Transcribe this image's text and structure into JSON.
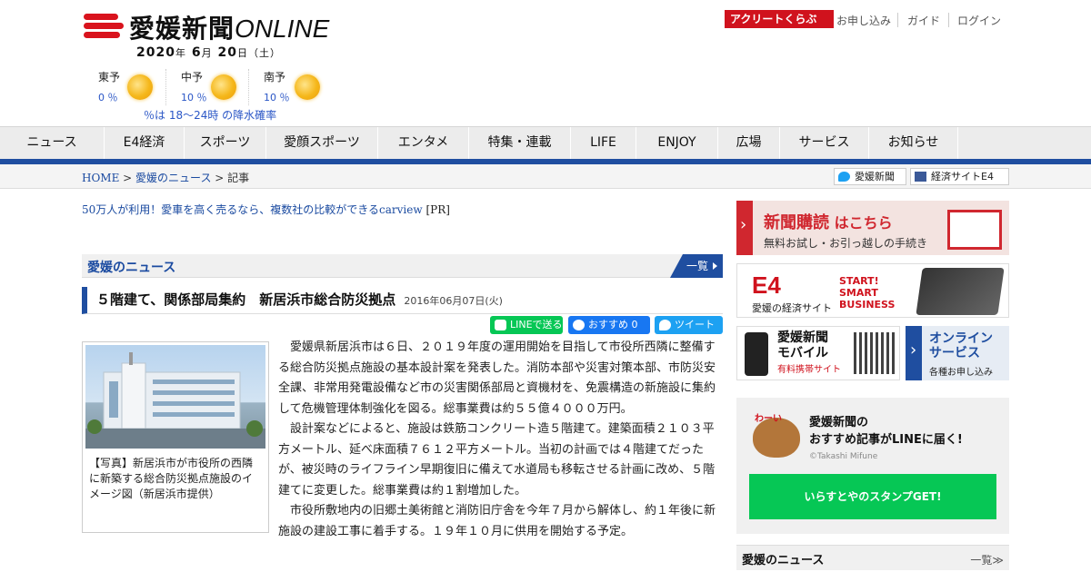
{
  "site": {
    "logo_text": "愛媛新聞",
    "logo_suffix": "ONLINE",
    "date": {
      "year": "2020",
      "month": "6",
      "day": "20",
      "weekday": "（土）",
      "y": "年",
      "m": "月",
      "d": "日"
    }
  },
  "weather": {
    "areas": [
      {
        "name": "東予",
        "pct": "0 ％",
        "icon": "sun-icon"
      },
      {
        "name": "中予",
        "pct": "10 ％",
        "icon": "sun-icon"
      },
      {
        "name": "南予",
        "pct": "10 ％",
        "icon": "sun-icon"
      }
    ],
    "note": "％は 18～24時 の降水確率"
  },
  "top": {
    "acli": "アクリートくらぶ",
    "links": [
      "お申し込み",
      "ガイド",
      "ログイン"
    ]
  },
  "nav": [
    "ニュース",
    "E4経済",
    "スポーツ",
    "愛顔スポーツ",
    "エンタメ",
    "特集・連載",
    "LIFE",
    "ENJOY",
    "広場",
    "サービス",
    "お知らせ"
  ],
  "breadcrumb": {
    "home": "HOME",
    "sep": " > ",
    "cat": "愛媛のニュース",
    "current": "記事"
  },
  "share_top": {
    "twitter": "愛媛新聞",
    "facebook": "経済サイトE4"
  },
  "pr": {
    "text": "50万人が利用！愛車を高く売るなら、複数社の比較ができるcarview",
    "tag": " [PR]"
  },
  "section": {
    "title": "愛媛のニュース",
    "more": "一覧"
  },
  "article": {
    "title": "５階建て、関係部局集約　新居浜市総合防災拠点",
    "date": "2016年06月07日(火)",
    "sns": {
      "line": "LINEで送る",
      "fb": "おすすめ 0",
      "tw": "ツイート"
    },
    "caption": "【写真】新居浜市が市役所の西隣に新築する総合防災拠点施設のイメージ図（新居浜市提供）",
    "paragraphs": [
      "愛媛県新居浜市は６日、２０１９年度の運用開始を目指して市役所西隣に整備する総合防災拠点施設の基本設計案を発表した。消防本部や災害対策本部、市防災安全課、非常用発電設備など市の災害関係部局と資機材を、免震構造の新施設に集約して危機管理体制強化を図る。総事業費は約５５億４０００万円。",
      "設計案などによると、施設は鉄筋コンクリート造５階建て。建築面積２１０３平方メートル、延べ床面積７６１２平方メートル。当初の計画では４階建てだったが、被災時のライフライン早期復旧に備えて水道局も移転させる計画に改め、５階建てに変更した。総事業費は約１割増加した。",
      "市役所敷地内の旧郷土美術館と消防旧庁舎を今年７月から解体し、約１年後に新施設の建設工事に着手する。１９年１０月に供用を開始する予定。"
    ]
  },
  "side": {
    "subscribe": {
      "title": "新聞購読",
      "suffix": " はこちら",
      "sub": "無料お試し・お引っ越しの手続き"
    },
    "e4": {
      "logo": "E4",
      "caption": "愛媛の経済サイト",
      "l1": "START!",
      "l2": "SMART",
      "l3": "BUSINESS"
    },
    "mobile": {
      "l1": "愛媛新聞",
      "l2": "モバイル",
      "sub": "有料携帯サイト"
    },
    "online": {
      "l1": "オンライン",
      "l2": "サービス",
      "sub": "各種お申し込み"
    },
    "line": {
      "wa": "わーい",
      "t1": "愛媛新聞の",
      "t2": "おすすめ記事がLINEに届く!",
      "credit": "©Takashi Mifune",
      "button": "いらすとやのスタンプGET!"
    },
    "news_head": {
      "title": "愛媛のニュース",
      "more": "一覧≫"
    }
  },
  "colors": {
    "accent": "#1f4ea0",
    "brand_red": "#d0121d",
    "line_green": "#06c755",
    "fb_blue": "#1877f2",
    "tw_blue": "#1da1f2"
  }
}
